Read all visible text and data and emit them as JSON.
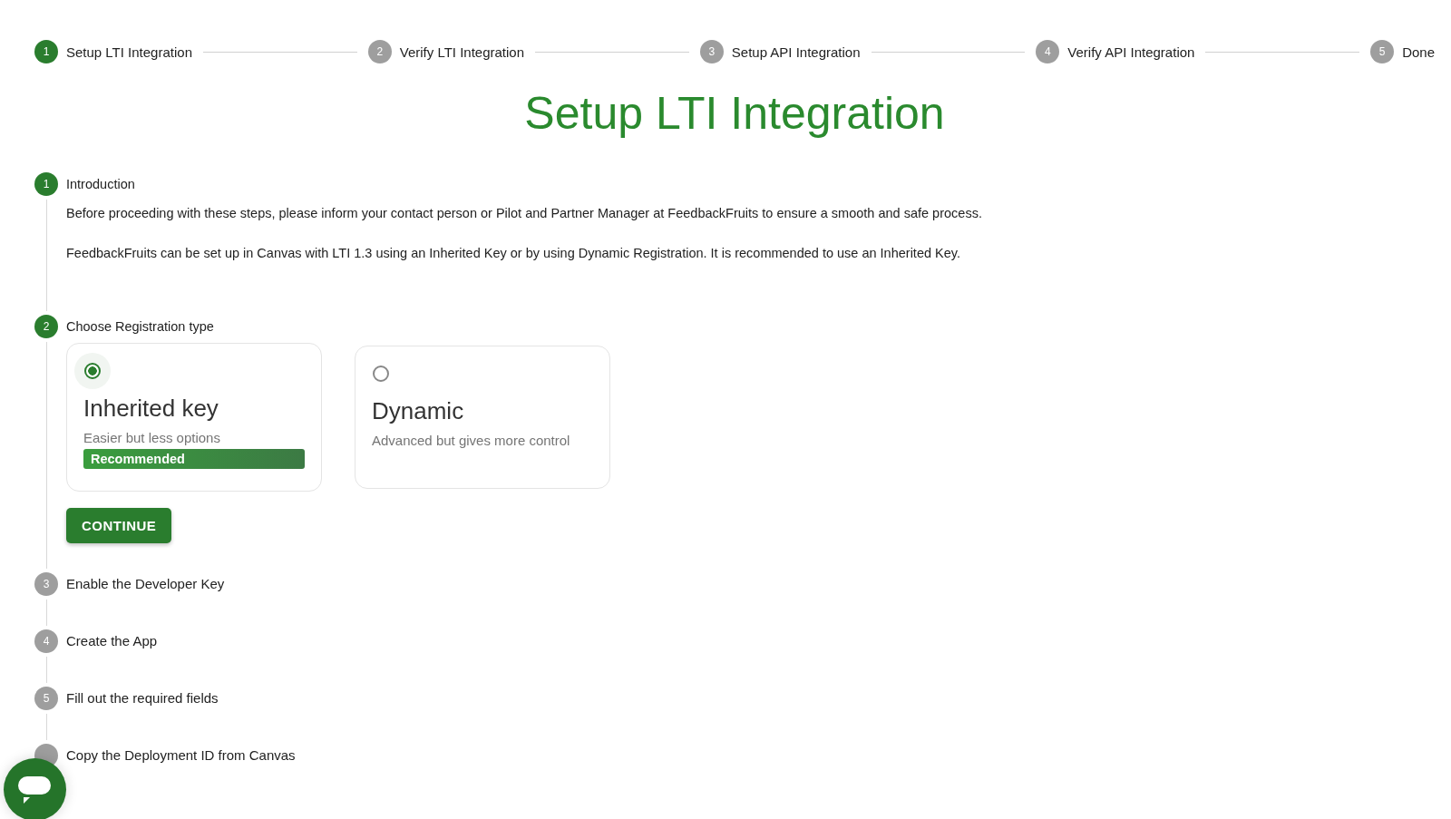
{
  "stepper": [
    {
      "number": "1",
      "label": "Setup LTI Integration",
      "active": true
    },
    {
      "number": "2",
      "label": "Verify LTI Integration",
      "active": false
    },
    {
      "number": "3",
      "label": "Setup API Integration",
      "active": false
    },
    {
      "number": "4",
      "label": "Verify API Integration",
      "active": false
    },
    {
      "number": "5",
      "label": "Done",
      "active": false
    }
  ],
  "title": "Setup LTI Integration",
  "steps": [
    {
      "number": "1",
      "label": "Introduction",
      "active": true,
      "paragraphs": [
        "Before proceeding with these steps, please inform your contact person or Pilot and Partner Manager at FeedbackFruits to ensure a smooth and safe process.",
        "FeedbackFruits can be set up in Canvas with LTI 1.3 using an Inherited Key or by using Dynamic Registration. It is recommended to use an Inherited Key."
      ]
    },
    {
      "number": "2",
      "label": "Choose Registration type",
      "active": true,
      "options": [
        {
          "title": "Inherited key",
          "subtitle": "Easier but less options",
          "badge": "Recommended",
          "selected": true
        },
        {
          "title": "Dynamic",
          "subtitle": "Advanced but gives more control",
          "selected": false
        }
      ],
      "button": "CONTINUE"
    },
    {
      "number": "3",
      "label": "Enable the Developer Key",
      "active": false
    },
    {
      "number": "4",
      "label": "Create the App",
      "active": false
    },
    {
      "number": "5",
      "label": "Fill out the required fields",
      "active": false
    },
    {
      "label": "Copy the Deployment ID from Canvas",
      "active": false
    }
  ]
}
